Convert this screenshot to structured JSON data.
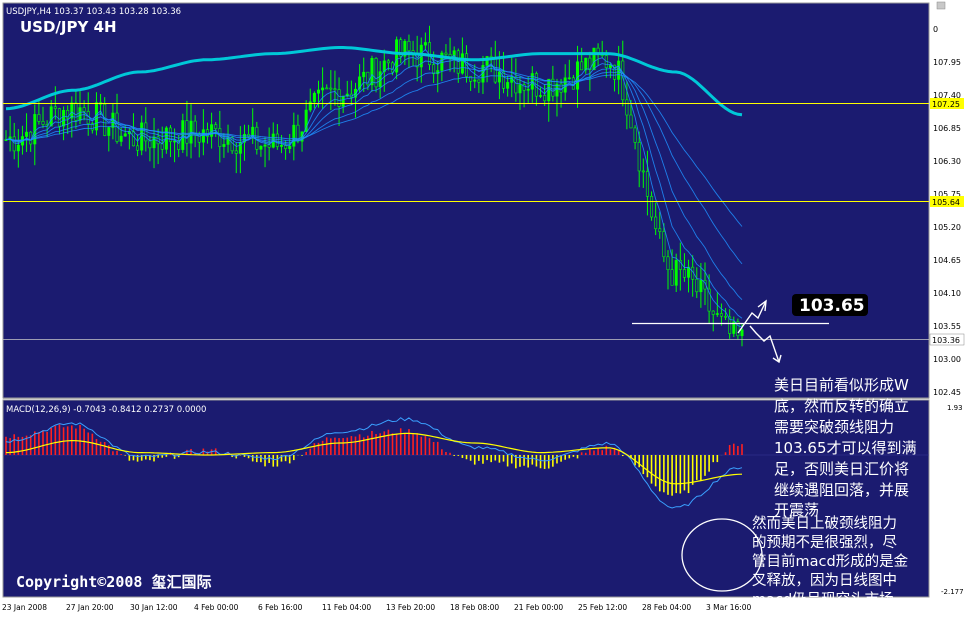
{
  "header": {
    "info_line": "USDJPY,H4  103.37 103.43 103.28 103.36",
    "title": "USD/JPY 4H"
  },
  "price_axis": {
    "ticks": [
      "0",
      "107.95",
      "107.40",
      "106.85",
      "106.30",
      "105.75",
      "105.20",
      "104.65",
      "104.10",
      "103.55",
      "103.00",
      "102.45"
    ],
    "current_price": "103.36"
  },
  "levels": {
    "upper": "107.25",
    "middle": "105.64",
    "neckline": "103.65"
  },
  "macd": {
    "label": "MACD(12,26,9) -0.7043 -0.8412 0.2737 0.0000",
    "axis_top": "1.93",
    "axis_bottom": "-2.177"
  },
  "time_axis": [
    "23 Jan 2008",
    "27 Jan 20:00",
    "30 Jan 12:00",
    "4 Feb 00:00",
    "6 Feb 16:00",
    "11 Feb 04:00",
    "13 Feb 20:00",
    "18 Feb 08:00",
    "21 Feb 00:00",
    "25 Feb 12:00",
    "28 Feb 04:00",
    "3 Mar 16:00"
  ],
  "annotations": {
    "para1": [
      "美日目前看似形成W",
      "底，然而反转的确立",
      "需要突破颈线阻力",
      "103.65才可以得到满",
      "足，否则美日汇价将",
      "继续遇阻回落，并展",
      "开震荡"
    ],
    "para2": [
      "然而美日上破颈线阻力",
      "的预期不是很强烈，尽",
      "管目前macd形成的是金",
      "叉释放，因为日线图中",
      "macd仍呈现空头市场"
    ]
  },
  "copyright": "Copyright©2008 玺汇国际",
  "colors": {
    "background": "#1b1b70",
    "candle": "#00ff00",
    "ma_main": "#00c8d8",
    "ma_thin": "#1e90ff",
    "level_line": "#ffff00",
    "macd_up": "#ff2020",
    "macd_down": "#ffff00",
    "macd_signal": "#ffff00",
    "macd_line": "#3aa0ff"
  },
  "chart_data": [
    {
      "type": "candlestick",
      "title": "USD/JPY 4H",
      "symbol": "USDJPY",
      "timeframe": "H4",
      "ohlc_current": {
        "open": 103.37,
        "high": 103.43,
        "low": 103.28,
        "close": 103.36
      },
      "x": [
        "23 Jan 2008",
        "27 Jan 20:00",
        "30 Jan 12:00",
        "4 Feb 00:00",
        "6 Feb 16:00",
        "11 Feb 04:00",
        "13 Feb 20:00",
        "18 Feb 08:00",
        "21 Feb 00:00",
        "25 Feb 12:00",
        "28 Feb 04:00",
        "3 Mar 16:00"
      ],
      "close_approx": [
        106.5,
        107.0,
        106.5,
        106.6,
        106.4,
        107.3,
        107.9,
        107.7,
        107.4,
        107.8,
        104.3,
        103.2
      ],
      "ylim": [
        102.45,
        108.3
      ],
      "horizontal_lines": [
        107.25,
        105.64,
        103.65
      ],
      "moving_average_main": [
        107.0,
        107.3,
        107.6,
        107.8,
        107.9,
        108.0,
        107.9,
        107.8,
        107.9,
        107.9,
        107.6,
        106.9
      ]
    },
    {
      "type": "bar",
      "title": "MACD(12,26,9) -0.7043 -0.8412 0.2737 0.0000",
      "x": [
        "23 Jan 2008",
        "27 Jan 20:00",
        "30 Jan 12:00",
        "4 Feb 00:00",
        "6 Feb 16:00",
        "11 Feb 04:00",
        "13 Feb 20:00",
        "18 Feb 08:00",
        "21 Feb 00:00",
        "25 Feb 12:00",
        "28 Feb 04:00",
        "3 Mar 16:00"
      ],
      "histogram_approx": [
        0.8,
        1.2,
        -0.3,
        0.2,
        -0.4,
        0.8,
        1.0,
        -0.3,
        -0.5,
        0.3,
        -1.7,
        0.5
      ],
      "signal_approx": [
        0.1,
        0.6,
        0.1,
        0.0,
        0.1,
        0.5,
        0.9,
        0.5,
        0.1,
        0.3,
        -1.2,
        -0.8
      ],
      "ylim": [
        -2.177,
        1.93
      ],
      "current": {
        "macd": -0.7043,
        "signal": -0.8412,
        "histogram": 0.2737,
        "zero": 0.0
      }
    }
  ]
}
